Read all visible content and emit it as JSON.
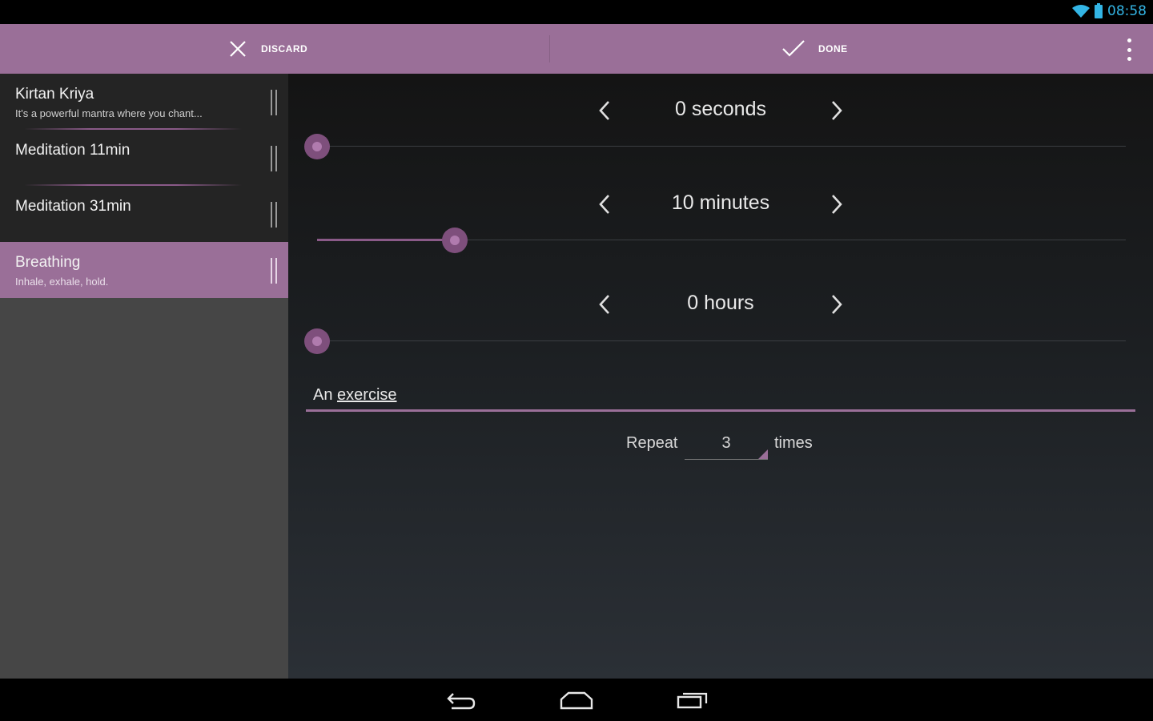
{
  "status_bar": {
    "time": "08:58",
    "accent_color": "#33b5e5"
  },
  "action_bar": {
    "discard_label": "DISCARD",
    "done_label": "DONE",
    "background_color": "#9a6f98"
  },
  "sidebar": {
    "items": [
      {
        "title": "Kirtan Kriya",
        "subtitle": "It's a powerful mantra where you chant...",
        "selected": false
      },
      {
        "title": "Meditation 11min",
        "subtitle": "",
        "selected": false
      },
      {
        "title": "Meditation 31min",
        "subtitle": "",
        "selected": false
      },
      {
        "title": "Breathing",
        "subtitle": "Inhale, exhale, hold.",
        "selected": true
      }
    ]
  },
  "editor": {
    "seconds": {
      "label": "0 seconds",
      "slider_fraction": 0.0
    },
    "minutes": {
      "label": "10 minutes",
      "slider_fraction": 0.17
    },
    "hours": {
      "label": "0 hours",
      "slider_fraction": 0.0
    },
    "name_prefix": "An",
    "name_word": "exercise",
    "repeat_label": "Repeat",
    "repeat_value": "3",
    "times_label": "times"
  },
  "icons": {
    "discard": "close-icon",
    "done": "checkmark-icon",
    "overflow": "more-vertical-icon",
    "back": "back-icon",
    "home": "home-icon",
    "recents": "recent-apps-icon"
  }
}
